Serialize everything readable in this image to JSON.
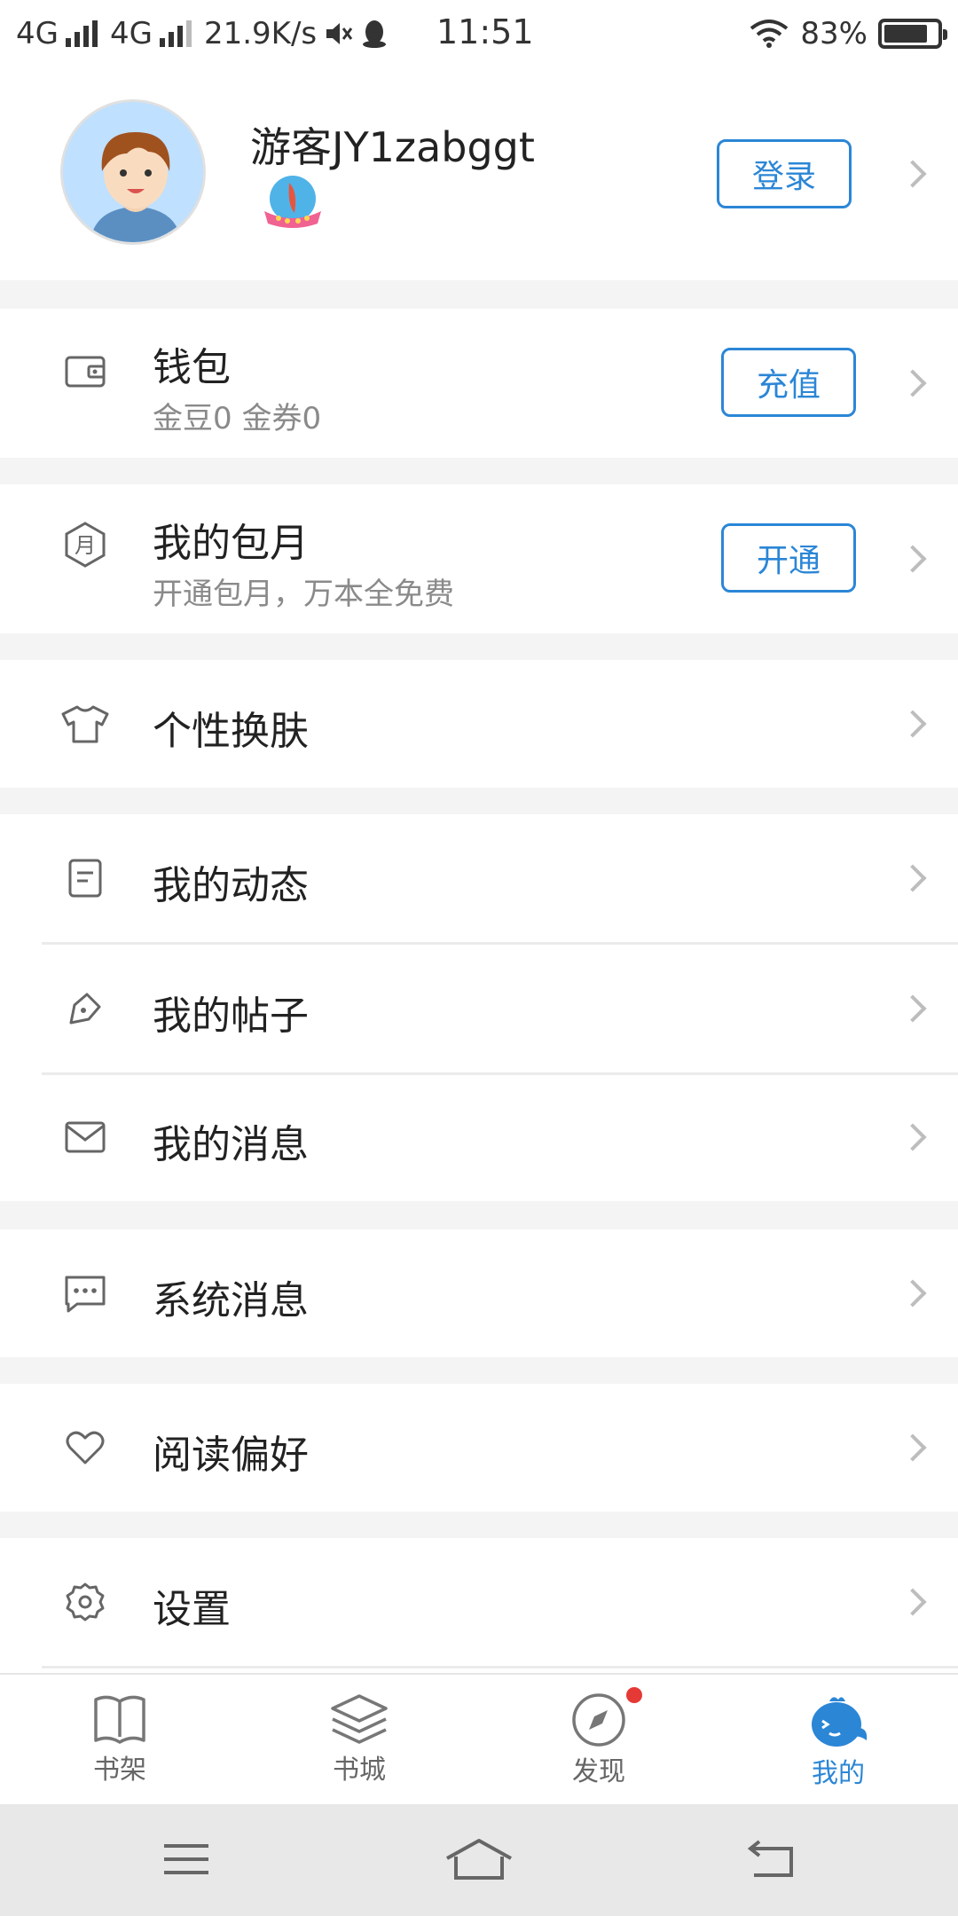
{
  "status_bar": {
    "network_1": "4G",
    "network_2": "4G",
    "speed": "21.9K/s",
    "time": "11:51",
    "battery": "83%",
    "battery_level": 0.83
  },
  "profile": {
    "username": "游客JY1zabggt",
    "login_label": "登录"
  },
  "wallet": {
    "title": "钱包",
    "subtitle": "金豆0 金券0",
    "button_label": "充值"
  },
  "monthly": {
    "title": "我的包月",
    "subtitle": "开通包月，万本全免费",
    "button_label": "开通",
    "icon_char": "月"
  },
  "menu": {
    "skin": "个性换肤",
    "activity": "我的动态",
    "posts": "我的帖子",
    "messages": "我的消息",
    "system_messages": "系统消息",
    "reading_prefs": "阅读偏好",
    "settings": "设置"
  },
  "bottom_nav": {
    "items": [
      {
        "label": "书架",
        "icon": "book-icon"
      },
      {
        "label": "书城",
        "icon": "layers-icon"
      },
      {
        "label": "发现",
        "icon": "compass-icon"
      },
      {
        "label": "我的",
        "icon": "mascot-icon"
      }
    ],
    "active": "我的"
  },
  "colors": {
    "accent": "#2b86d6",
    "badge_red": "#e53935"
  }
}
